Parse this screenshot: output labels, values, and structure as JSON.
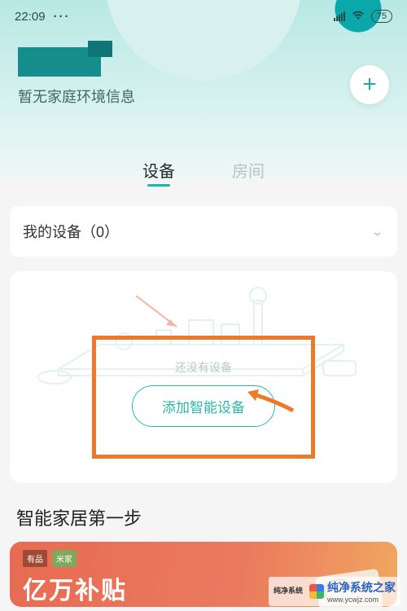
{
  "status": {
    "time": "22:09",
    "dots": "···",
    "battery": "75"
  },
  "home": {
    "env_info": "暂无家庭环境信息"
  },
  "tabs": {
    "devices": "设备",
    "rooms": "房间"
  },
  "devices": {
    "my_devices_label": "我的设备（0）"
  },
  "empty": {
    "no_device": "还没有设备",
    "add_button": "添加智能设备"
  },
  "smart_home": {
    "title": "智能家居第一步"
  },
  "promo": {
    "badge1": "有品",
    "badge2": "米家",
    "headline": "亿万补贴"
  },
  "watermark": {
    "label": "纯净系统",
    "text": "纯净系统之家",
    "url": "www.ycwjz.com"
  }
}
